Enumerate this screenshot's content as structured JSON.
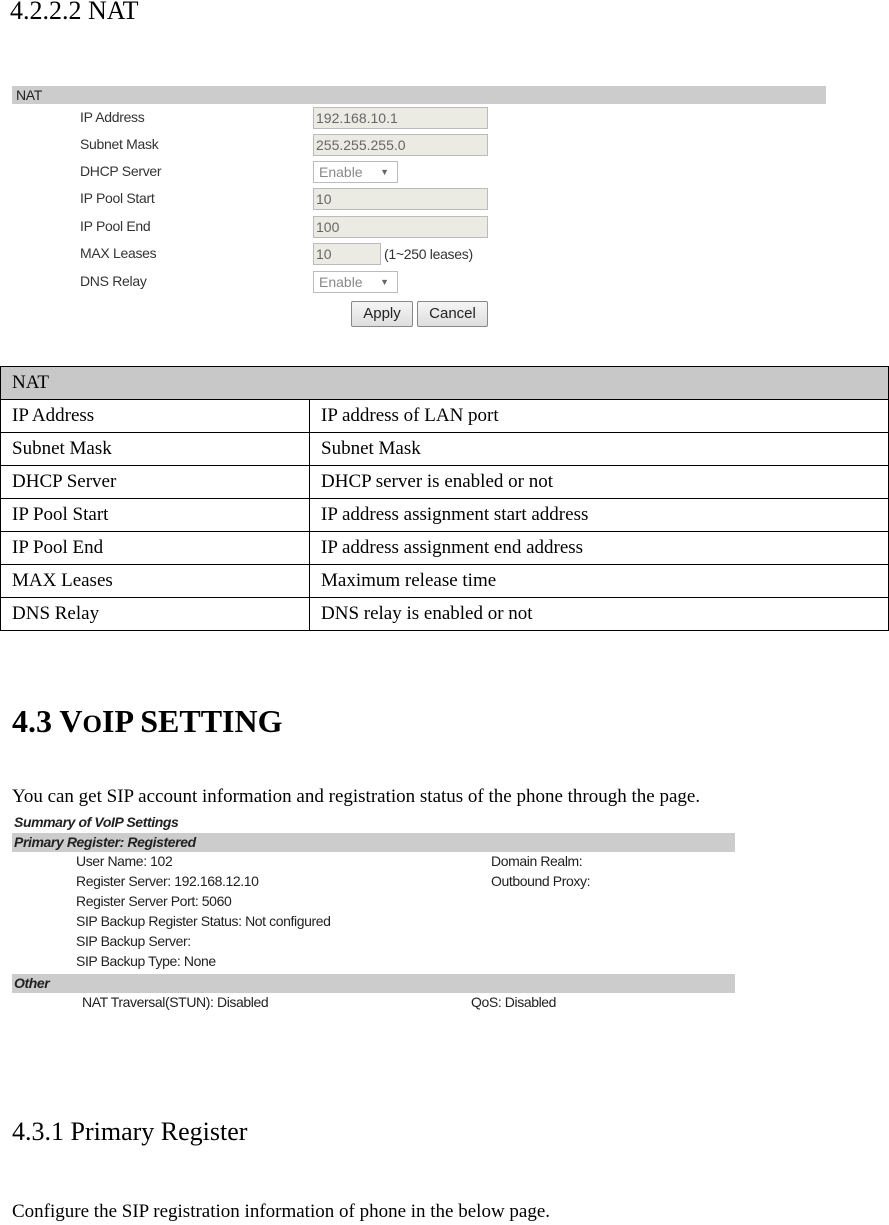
{
  "heading_nat": "4.2.2.2 NAT",
  "nat_ui": {
    "title": "NAT",
    "fields": [
      {
        "label": "IP Address",
        "value": "192.168.10.1",
        "type": "text"
      },
      {
        "label": "Subnet Mask",
        "value": "255.255.255.0",
        "type": "text"
      },
      {
        "label": "DHCP Server",
        "value": "Enable",
        "type": "select"
      },
      {
        "label": "IP Pool Start",
        "value": "10",
        "type": "text"
      },
      {
        "label": "IP Pool End",
        "value": "100",
        "type": "text"
      },
      {
        "label": "MAX Leases",
        "value": "10",
        "type": "text",
        "hint": "(1~250 leases)"
      },
      {
        "label": "DNS Relay",
        "value": "Enable",
        "type": "select"
      }
    ],
    "apply": "Apply",
    "cancel": "Cancel"
  },
  "nat_table": {
    "header": "NAT",
    "rows": [
      [
        "IP Address",
        "IP address of LAN port"
      ],
      [
        "Subnet Mask",
        "Subnet Mask"
      ],
      [
        "DHCP Server",
        "DHCP server is enabled or not"
      ],
      [
        "IP Pool Start",
        "IP address assignment start address"
      ],
      [
        "IP Pool End",
        "IP address assignment end address"
      ],
      [
        "MAX Leases",
        "Maximum release time"
      ],
      [
        "DNS Relay",
        "DNS relay is enabled or not"
      ]
    ]
  },
  "heading_voip": {
    "prefix": "4.3 V",
    "small": "O",
    "suffix": "IP SETTING"
  },
  "voip_intro": "You can get SIP account information and registration status of the phone through the page.",
  "summary": {
    "title": "Summary of VoIP Settings",
    "primary_bar": "Primary Register: Registered",
    "left": [
      "User Name: 102",
      "Register Server: 192.168.12.10",
      "Register Server Port: 5060",
      "SIP Backup Register Status: Not configured",
      "SIP Backup Server:",
      "SIP Backup Type: None"
    ],
    "right": [
      "Domain Realm:",
      "Outbound Proxy:"
    ],
    "other_bar": "Other",
    "nat_traversal": "NAT Traversal(STUN): Disabled",
    "qos": "QoS: Disabled"
  },
  "heading_primary": "4.3.1 Primary Register",
  "primary_intro": "Configure the SIP registration information of phone in the below page."
}
